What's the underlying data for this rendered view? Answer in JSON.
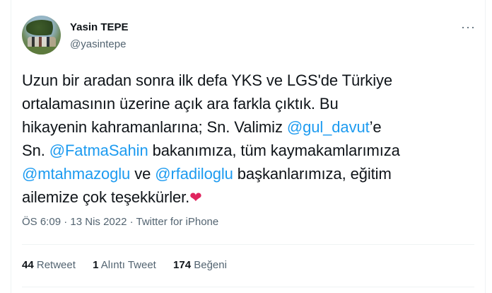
{
  "user": {
    "name": "Yasin TEPE",
    "handle": "@yasintepe"
  },
  "more_icon": "more-horizontal-icon",
  "tweet": {
    "line1": "Uzun bir aradan sonra ilk defa YKS ve LGS'de Türkiye",
    "line2": "ortalamasının üzerine açık ara farkla çıktık. Bu",
    "line3a": "hikayenin kahramanlarına; Sn. Valimiz ",
    "mention1": "@gul_davut",
    "line3b": "’e",
    "line4a": "Sn. ",
    "mention2": "@FatmaSahin",
    "line4b": " bakanımıza, tüm kaymakamlarımıza",
    "mention3": "@mtahmazoglu",
    "line5a": " ve ",
    "mention4": "@rfadiloglu",
    "line5b": " başkanlarımıza, eğitim",
    "line6": "ailemize çok teşekkürler.",
    "emoji": "❤"
  },
  "meta": {
    "time": "ÖS 6:09",
    "sep1": " · ",
    "date": "13 Nis 2022",
    "sep2": " · ",
    "source": "Twitter for iPhone"
  },
  "stats": {
    "retweets": "44",
    "retweets_label": "Retweet",
    "quotes": "1",
    "quotes_label": "Alıntı Tweet",
    "likes": "174",
    "likes_label": "Beğeni"
  },
  "colors": {
    "mention": "#1d9bf0",
    "secondary": "#536471",
    "heart": "#e0245e"
  }
}
